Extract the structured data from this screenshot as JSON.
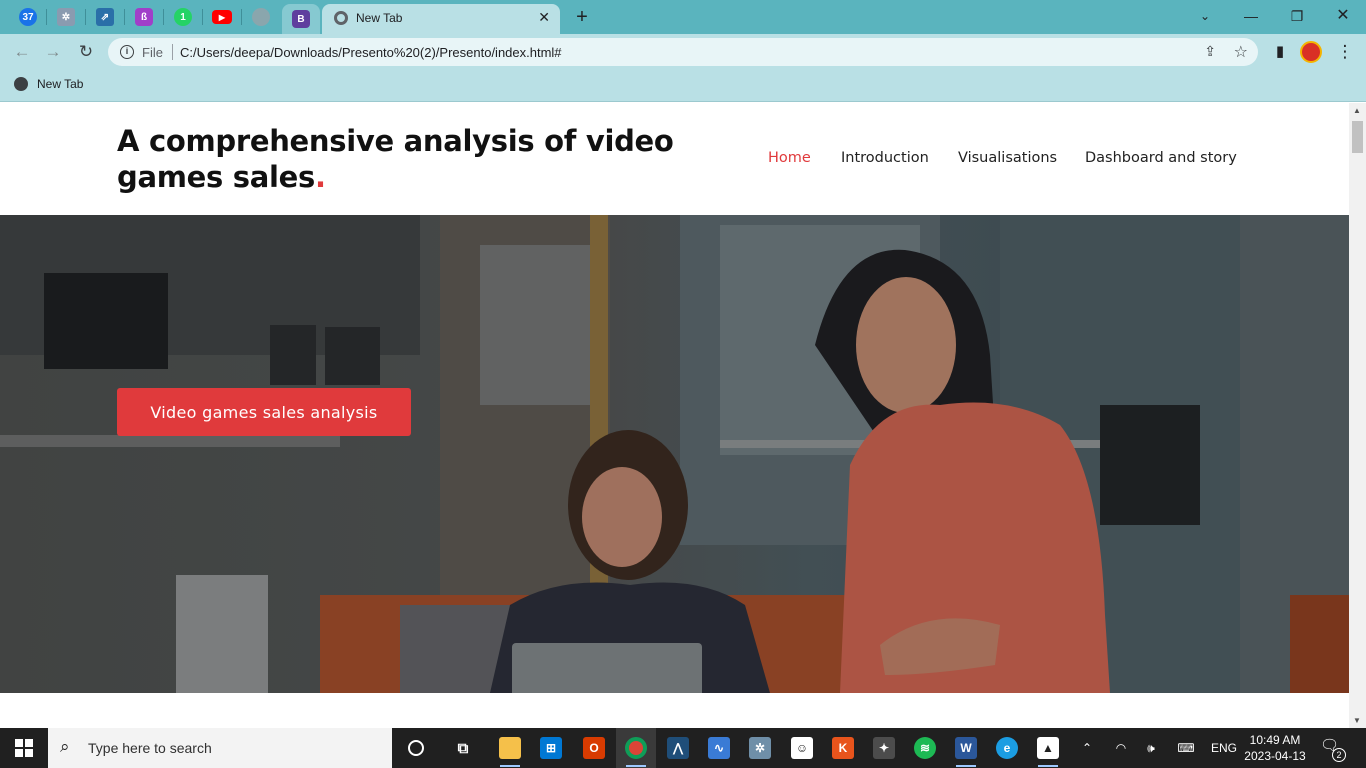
{
  "browser": {
    "pinned_tabs": [
      {
        "name": "tab-badge-37",
        "label": "37",
        "color": "#1a73e8"
      },
      {
        "name": "tab-app-2",
        "label": "",
        "color": "#8a9bb0"
      },
      {
        "name": "tab-app-3",
        "label": "",
        "color": "#2a6fa8"
      },
      {
        "name": "tab-app-4",
        "label": "",
        "color": "#a03fc9"
      },
      {
        "name": "tab-whatsapp",
        "label": "1",
        "color": "#25d366"
      },
      {
        "name": "tab-youtube",
        "label": "▶",
        "color": "#ff0000"
      },
      {
        "name": "tab-app-7",
        "label": "",
        "color": "#8aa6ad"
      }
    ],
    "bootstrap_tab_label": "B",
    "active_tab_title": "New Tab",
    "address_scheme": "File",
    "address_url": "C:/Users/deepa/Downloads/Presento%20(2)/Presento/index.html#",
    "bookmark_label": "New Tab"
  },
  "site": {
    "title": "A comprehensive analysis of video games sales",
    "title_dot": ".",
    "nav": [
      "Home",
      "Introduction",
      "Visualisations",
      "Dashboard and story"
    ],
    "active_nav": "Home",
    "hero_button": "Video games sales analysis",
    "accent_color": "#e03a3c"
  },
  "taskbar": {
    "search_placeholder": "Type here to search",
    "language": "ENG",
    "time": "10:49 AM",
    "date": "2023-04-13",
    "notification_count": "2"
  }
}
